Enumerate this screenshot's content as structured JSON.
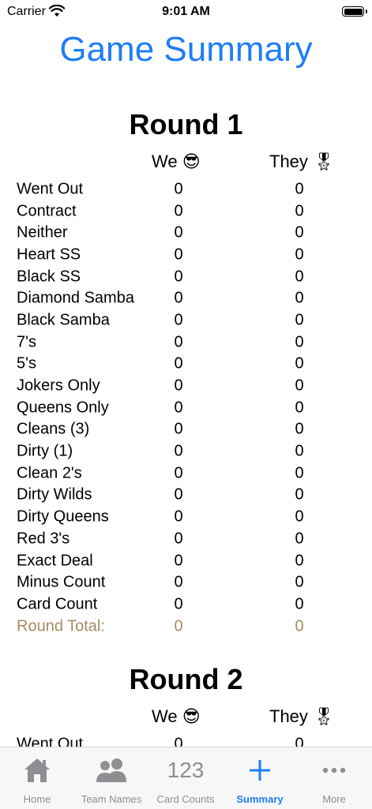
{
  "status_bar": {
    "carrier": "Carrier",
    "time": "9:01 AM"
  },
  "page_title": "Game Summary",
  "teams": {
    "we": "We 😎",
    "they": "They 🎖"
  },
  "rounds": [
    {
      "title": "Round 1",
      "rows": [
        {
          "label": "Went Out",
          "we": "0",
          "they": "0"
        },
        {
          "label": "Contract",
          "we": "0",
          "they": "0"
        },
        {
          "label": "Neither",
          "we": "0",
          "they": "0"
        },
        {
          "label": "Heart SS",
          "we": "0",
          "they": "0"
        },
        {
          "label": "Black SS",
          "we": "0",
          "they": "0"
        },
        {
          "label": "Diamond Samba",
          "we": "0",
          "they": "0"
        },
        {
          "label": "Black Samba",
          "we": "0",
          "they": "0"
        },
        {
          "label": "7's",
          "we": "0",
          "they": "0"
        },
        {
          "label": "5's",
          "we": "0",
          "they": "0"
        },
        {
          "label": "Jokers Only",
          "we": "0",
          "they": "0"
        },
        {
          "label": "Queens Only",
          "we": "0",
          "they": "0"
        },
        {
          "label": "Cleans (3)",
          "we": "0",
          "they": "0"
        },
        {
          "label": "Dirty (1)",
          "we": "0",
          "they": "0"
        },
        {
          "label": "Clean 2's",
          "we": "0",
          "they": "0"
        },
        {
          "label": "Dirty Wilds",
          "we": "0",
          "they": "0"
        },
        {
          "label": "Dirty Queens",
          "we": "0",
          "they": "0"
        },
        {
          "label": "Red 3's",
          "we": "0",
          "they": "0"
        },
        {
          "label": "Exact Deal",
          "we": "0",
          "they": "0"
        },
        {
          "label": "Minus Count",
          "we": "0",
          "they": "0"
        },
        {
          "label": "Card Count",
          "we": "0",
          "they": "0"
        }
      ],
      "total": {
        "label": "Round Total:",
        "we": "0",
        "they": "0"
      }
    },
    {
      "title": "Round 2",
      "rows": [
        {
          "label": "Went Out",
          "we": "0",
          "they": "0"
        }
      ]
    }
  ],
  "tab_bar": {
    "items": [
      {
        "label": "Home",
        "icon": "house-icon"
      },
      {
        "label": "Team Names",
        "icon": "people-icon"
      },
      {
        "label": "Card Counts",
        "icon": "123-icon",
        "icon_text": "123"
      },
      {
        "label": "Summary",
        "icon": "plus-icon",
        "active": true
      },
      {
        "label": "More",
        "icon": "ellipsis-icon"
      }
    ],
    "active_color": "#1f7df6",
    "inactive_color": "#8e8e93"
  },
  "colors": {
    "title_blue": "#1f7df6",
    "total_tan": "#a58b63"
  }
}
